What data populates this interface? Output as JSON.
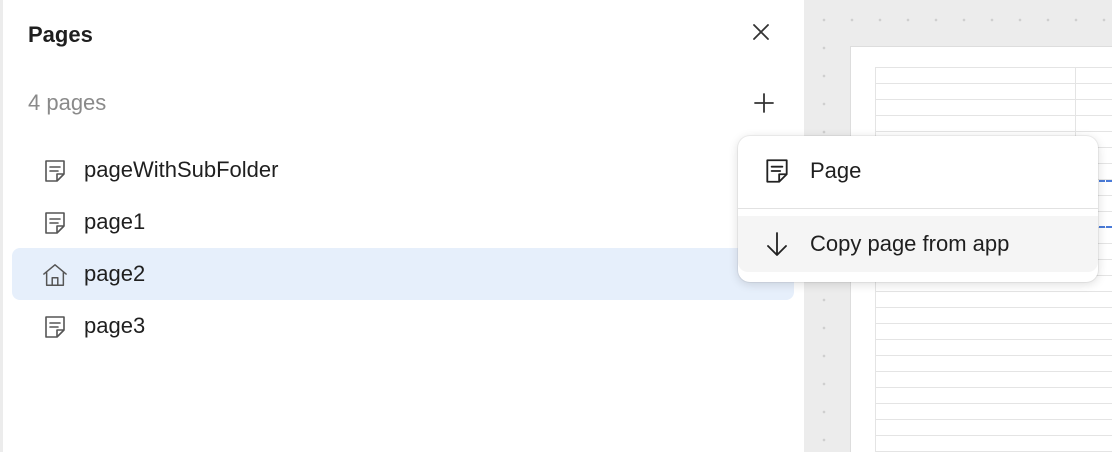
{
  "panel": {
    "title": "Pages",
    "page_count": "4 pages",
    "close_icon": "close-icon",
    "add_icon": "plus-icon"
  },
  "pages": [
    {
      "label": "pageWithSubFolder",
      "icon": "page-icon",
      "selected": false
    },
    {
      "label": "page1",
      "icon": "page-icon",
      "selected": false
    },
    {
      "label": "page2",
      "icon": "home-icon",
      "selected": true
    },
    {
      "label": "page3",
      "icon": "page-icon",
      "selected": false
    }
  ],
  "menu": {
    "items": [
      {
        "label": "Page",
        "icon": "page-icon"
      },
      {
        "label": "Copy page from app",
        "icon": "arrow-down-icon"
      }
    ]
  },
  "colors": {
    "selected_bg": "#e6effb",
    "muted_text": "#8a8a8a",
    "canvas_bg": "#ececec"
  }
}
